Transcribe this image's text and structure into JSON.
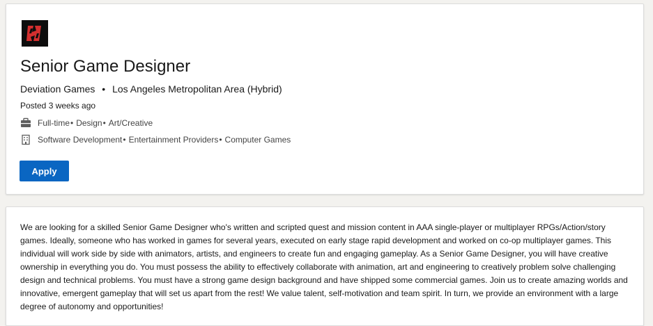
{
  "job": {
    "title": "Senior Game Designer",
    "company": "Deviation Games",
    "separator": "•",
    "location": "Los Angeles Metropolitan Area (Hybrid)",
    "posted": "Posted 3 weeks ago",
    "employment": [
      "Full-time",
      "Design",
      "Art/Creative"
    ],
    "industries": [
      "Software Development",
      "Entertainment Providers",
      "Computer Games"
    ],
    "apply_label": "Apply"
  },
  "icons": {
    "logo": "deviation-games-logo",
    "job_type": "briefcase-icon",
    "industry": "building-icon"
  },
  "colors": {
    "accent": "#0a66c2",
    "logo_bg": "#0d0d0d",
    "logo_mark": "#d32f2f"
  },
  "description": "We are looking for a skilled Senior Game Designer who's written and scripted quest and mission content in AAA single-player or multiplayer RPGs/Action/story games. Ideally, someone who has worked in games for several years, executed on early stage rapid development and worked on co-op multiplayer games. This individual will work side by side with animators, artists, and engineers to create fun and engaging gameplay. As a Senior Game Designer, you will have creative ownership in everything you do. You must possess the ability to effectively collaborate with animation, art and engineering to creatively problem solve challenging design and technical problems. You must have a strong game design background and have shipped some commercial games. Join us to create amazing worlds and innovative, emergent gameplay that will set us apart from the rest! We value talent, self-motivation and team spirit. In turn, we provide an environment with a large degree of autonomy and opportunities!"
}
